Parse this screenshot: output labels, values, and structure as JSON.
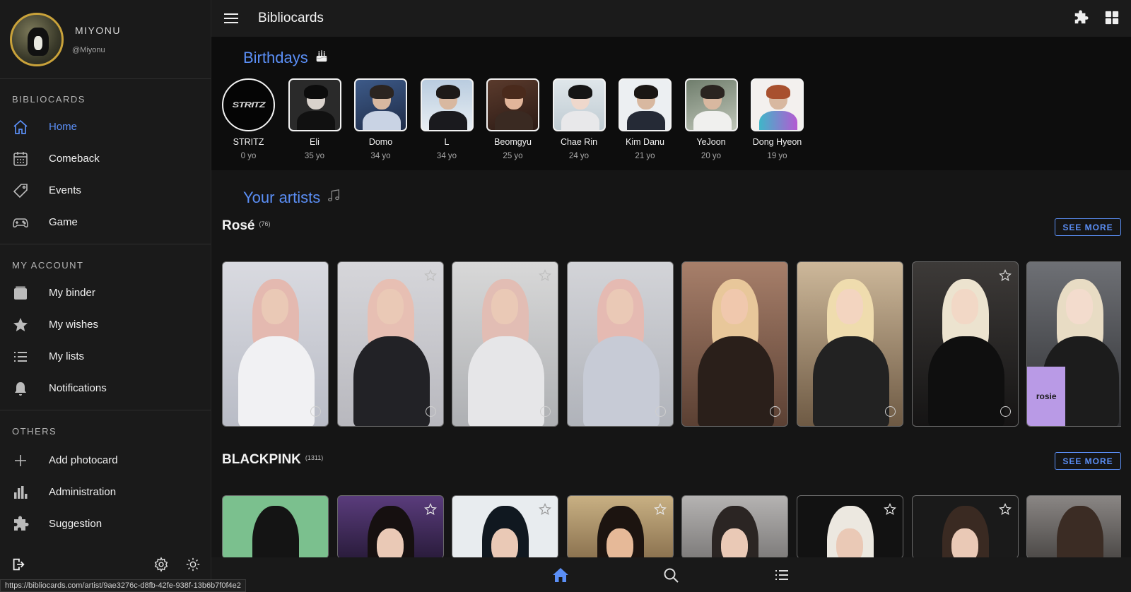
{
  "profile": {
    "name": "MIYONU",
    "handle": "@Miyonu"
  },
  "sidebar": {
    "sections": [
      {
        "label": "BIBLIOCARDS"
      },
      {
        "label": "MY ACCOUNT"
      },
      {
        "label": "OTHERS"
      }
    ],
    "items": [
      {
        "label": "Home",
        "icon": "home-icon",
        "active": true
      },
      {
        "label": "Comeback",
        "icon": "calendar-icon"
      },
      {
        "label": "Events",
        "icon": "tag-icon"
      },
      {
        "label": "Game",
        "icon": "gamepad-icon"
      },
      {
        "label": "My binder",
        "icon": "binder-icon"
      },
      {
        "label": "My wishes",
        "icon": "star-icon"
      },
      {
        "label": "My lists",
        "icon": "list-icon"
      },
      {
        "label": "Notifications",
        "icon": "bell-icon"
      },
      {
        "label": "Add photocard",
        "icon": "plus-icon"
      },
      {
        "label": "Administration",
        "icon": "bar-chart-icon"
      },
      {
        "label": "Suggestion",
        "icon": "puzzle-icon"
      }
    ]
  },
  "header": {
    "title": "Bibliocards"
  },
  "birthdays": {
    "title": "Birthdays",
    "people": [
      {
        "name": "STRITZ",
        "age": "0 yo",
        "logo": "STRITZ"
      },
      {
        "name": "Eli",
        "age": "35 yo"
      },
      {
        "name": "Domo",
        "age": "34 yo"
      },
      {
        "name": "L",
        "age": "34 yo"
      },
      {
        "name": "Beomgyu",
        "age": "25 yo"
      },
      {
        "name": "Chae Rin",
        "age": "24 yo"
      },
      {
        "name": "Kim Danu",
        "age": "21 yo"
      },
      {
        "name": "YeJoon",
        "age": "20 yo"
      },
      {
        "name": "Dong Hyeon",
        "age": "19 yo"
      }
    ]
  },
  "artists": {
    "title": "Your artists",
    "groups": [
      {
        "name": "Rosé",
        "count": "(76)",
        "see_more": "SEE MORE",
        "card_count": 8,
        "card_overlay": "rosie"
      },
      {
        "name": "BLACKPINK",
        "count": "(1311)",
        "see_more": "SEE MORE",
        "card_count": 8
      }
    ]
  },
  "status_url": "https://bibliocards.com/artist/9ae3276c-d8fb-42fe-938f-13b6b7f0f4e2",
  "colors": {
    "accent": "#5b8ff6",
    "background": "#151515",
    "sidebar": "#1a1a1a",
    "birthday_strip": "#0d0d0d"
  }
}
